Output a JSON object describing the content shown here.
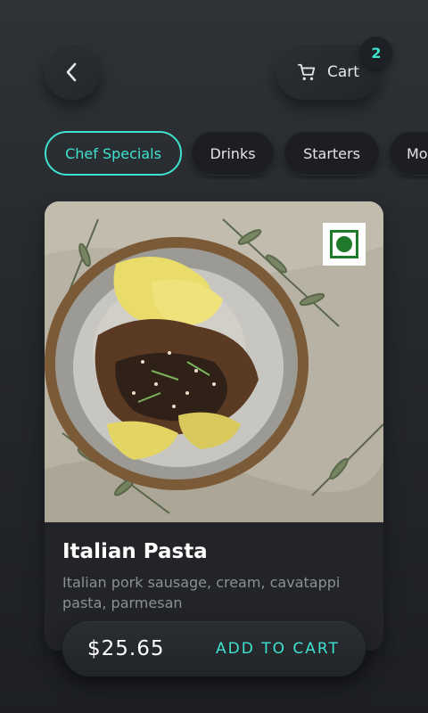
{
  "header": {
    "back_icon": "chevron-left-icon",
    "cart": {
      "label": "Cart",
      "icon": "cart-icon",
      "count": "2"
    }
  },
  "categories": [
    {
      "label": "Chef Specials",
      "active": true
    },
    {
      "label": "Drinks",
      "active": false
    },
    {
      "label": "Starters",
      "active": false
    },
    {
      "label": "Mo",
      "active": false
    }
  ],
  "item": {
    "name": "Italian Pasta",
    "description": "Italian pork sausage, cream, cavatappi pasta, parmesan",
    "veg_indicator_icon": "veg-indicator-icon",
    "price": "$25.65",
    "add_label": "ADD TO CART"
  },
  "colors": {
    "accent": "#3ee2cf",
    "veg_green": "#1f7a2c",
    "background": "#25282c"
  }
}
